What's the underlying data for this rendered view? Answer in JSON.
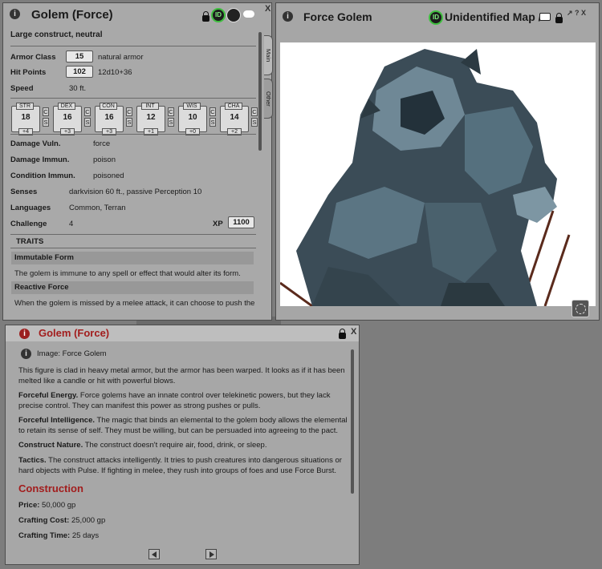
{
  "statblock": {
    "title": "Golem (Force)",
    "close": "X",
    "type_line": "Large construct, neutral",
    "armor_class": {
      "label": "Armor Class",
      "value": "15",
      "note": "natural armor"
    },
    "hit_points": {
      "label": "Hit Points",
      "value": "102",
      "note": "12d10+36"
    },
    "speed": {
      "label": "Speed",
      "value": "30 ft."
    },
    "abilities": [
      {
        "name": "STR",
        "score": "18",
        "mod": "+4"
      },
      {
        "name": "DEX",
        "score": "16",
        "mod": "+3"
      },
      {
        "name": "CON",
        "score": "16",
        "mod": "+3"
      },
      {
        "name": "INT",
        "score": "12",
        "mod": "+1"
      },
      {
        "name": "WIS",
        "score": "10",
        "mod": "+0"
      },
      {
        "name": "CHA",
        "score": "14",
        "mod": "+2"
      }
    ],
    "c_label": "C",
    "s_label": "S",
    "damage_vuln": {
      "label": "Damage Vuln.",
      "value": "force"
    },
    "damage_immun": {
      "label": "Damage Immun.",
      "value": "poison"
    },
    "condition_immun": {
      "label": "Condition Immun.",
      "value": "poisoned"
    },
    "senses": {
      "label": "Senses",
      "value": "darkvision 60 ft., passive Perception 10"
    },
    "languages": {
      "label": "Languages",
      "value": "Common, Terran"
    },
    "challenge": {
      "label": "Challenge",
      "value": "4",
      "xp_label": "XP",
      "xp_value": "1100"
    },
    "traits_header": "TRAITS",
    "trait1_name": "Immutable Form",
    "trait1_text": "The golem is immune to any spell or effect that would alter its form.",
    "trait2_name": "Reactive Force",
    "trait2_text": "When the golem is missed by a melee attack, it can choose to push the",
    "tabs": {
      "main": "Main",
      "other": "Other"
    }
  },
  "image_window": {
    "title": "Force Golem",
    "map_label": "Unidentified Map /",
    "controls": "↗ ? X"
  },
  "story": {
    "title": "Golem (Force)",
    "close": "X",
    "image_link": "Image: Force Golem",
    "p1": "This figure is clad in heavy metal armor, but the armor has been warped. It looks as if it has been melted like a candle or hit with powerful blows.",
    "p2_b": "Forceful Energy.",
    "p2": " Force golems have an innate control over telekinetic powers, but they lack precise control. They can manifest this power as strong pushes or pulls.",
    "p3_b": "Forceful Intelligence.",
    "p3": " The magic that binds an elemental to the golem body allows the elemental to retain its sense of self. They must be willing, but can be persuaded into agreeing to the pact.",
    "p4_b": "Construct Nature.",
    "p4": " The construct doesn't require air, food, drink, or sleep.",
    "p5_b": "Tactics.",
    "p5": " The construct attacks intelligently. It tries to push creatures into dangerous situations or hard objects with Pulse. If fighting in melee, they rush into groups of foes and use Force Burst.",
    "construction_header": "Construction",
    "price_b": "Price:",
    "price": " 50,000 gp",
    "cost_b": "Crafting Cost:",
    "cost": " 25,000 gp",
    "time_b": "Crafting Time:",
    "time": " 25 days"
  },
  "colors": {
    "accent_red": "#a21d1d",
    "id_green": "#3fbf3f"
  }
}
